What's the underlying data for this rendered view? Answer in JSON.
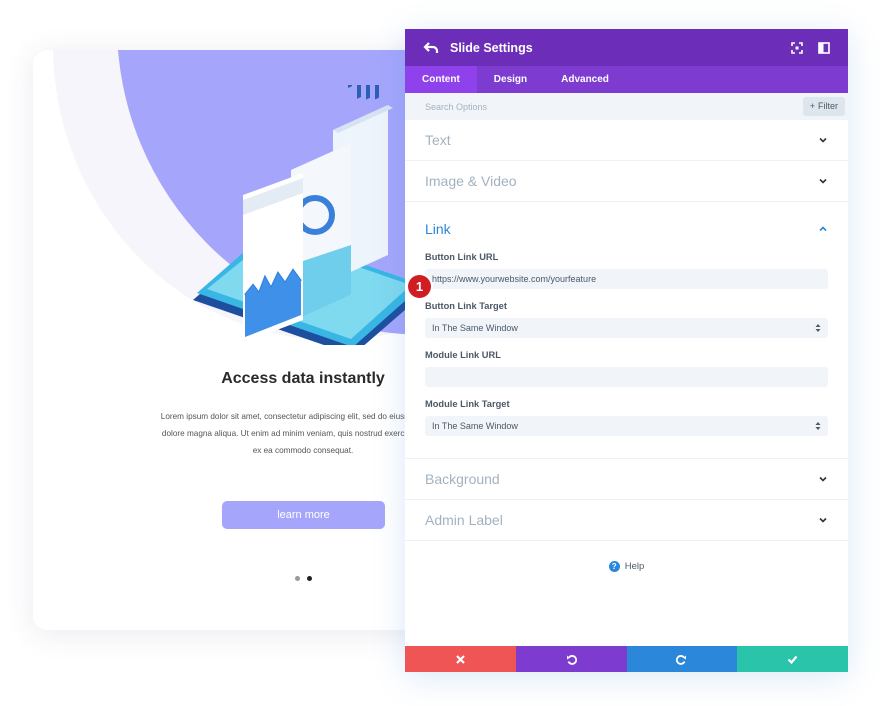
{
  "preview": {
    "title": "Access data instantly",
    "body_lines": [
      "Lorem ipsum dolor sit amet, consectetur adipiscing elit, sed do eiusmod tempo",
      "dolore magna aliqua. Ut enim ad minim veniam, quis nostrud exercitation ullar",
      "ex ea commodo consequat."
    ],
    "button_label": "learn more",
    "slide_count": 2,
    "active_slide": 2,
    "accent_color": "#a5a6fb"
  },
  "modal": {
    "title": "Slide Settings",
    "header_color": "#6c2eb9",
    "tabs": [
      {
        "label": "Content",
        "active": true
      },
      {
        "label": "Design",
        "active": false
      },
      {
        "label": "Advanced",
        "active": false
      }
    ],
    "search": {
      "placeholder": "Search Options",
      "filter_label": "Filter"
    },
    "sections_top": [
      {
        "label": "Text"
      },
      {
        "label": "Image & Video"
      }
    ],
    "link_section": {
      "label": "Link",
      "fields": [
        {
          "label": "Button Link URL",
          "value": "https://www.yourwebsite.com/yourfeature",
          "type": "text"
        },
        {
          "label": "Button Link Target",
          "value": "In The Same Window",
          "type": "select"
        },
        {
          "label": "Module Link URL",
          "value": "",
          "type": "text"
        },
        {
          "label": "Module Link Target",
          "value": "In The Same Window",
          "type": "select"
        }
      ]
    },
    "sections_bottom": [
      {
        "label": "Background"
      },
      {
        "label": "Admin Label"
      }
    ],
    "help_label": "Help",
    "step_badge": "1",
    "footer_colors": {
      "cancel": "#ef5555",
      "undo": "#7e3bd0",
      "redo": "#2b87da",
      "save": "#29c4a9"
    }
  }
}
